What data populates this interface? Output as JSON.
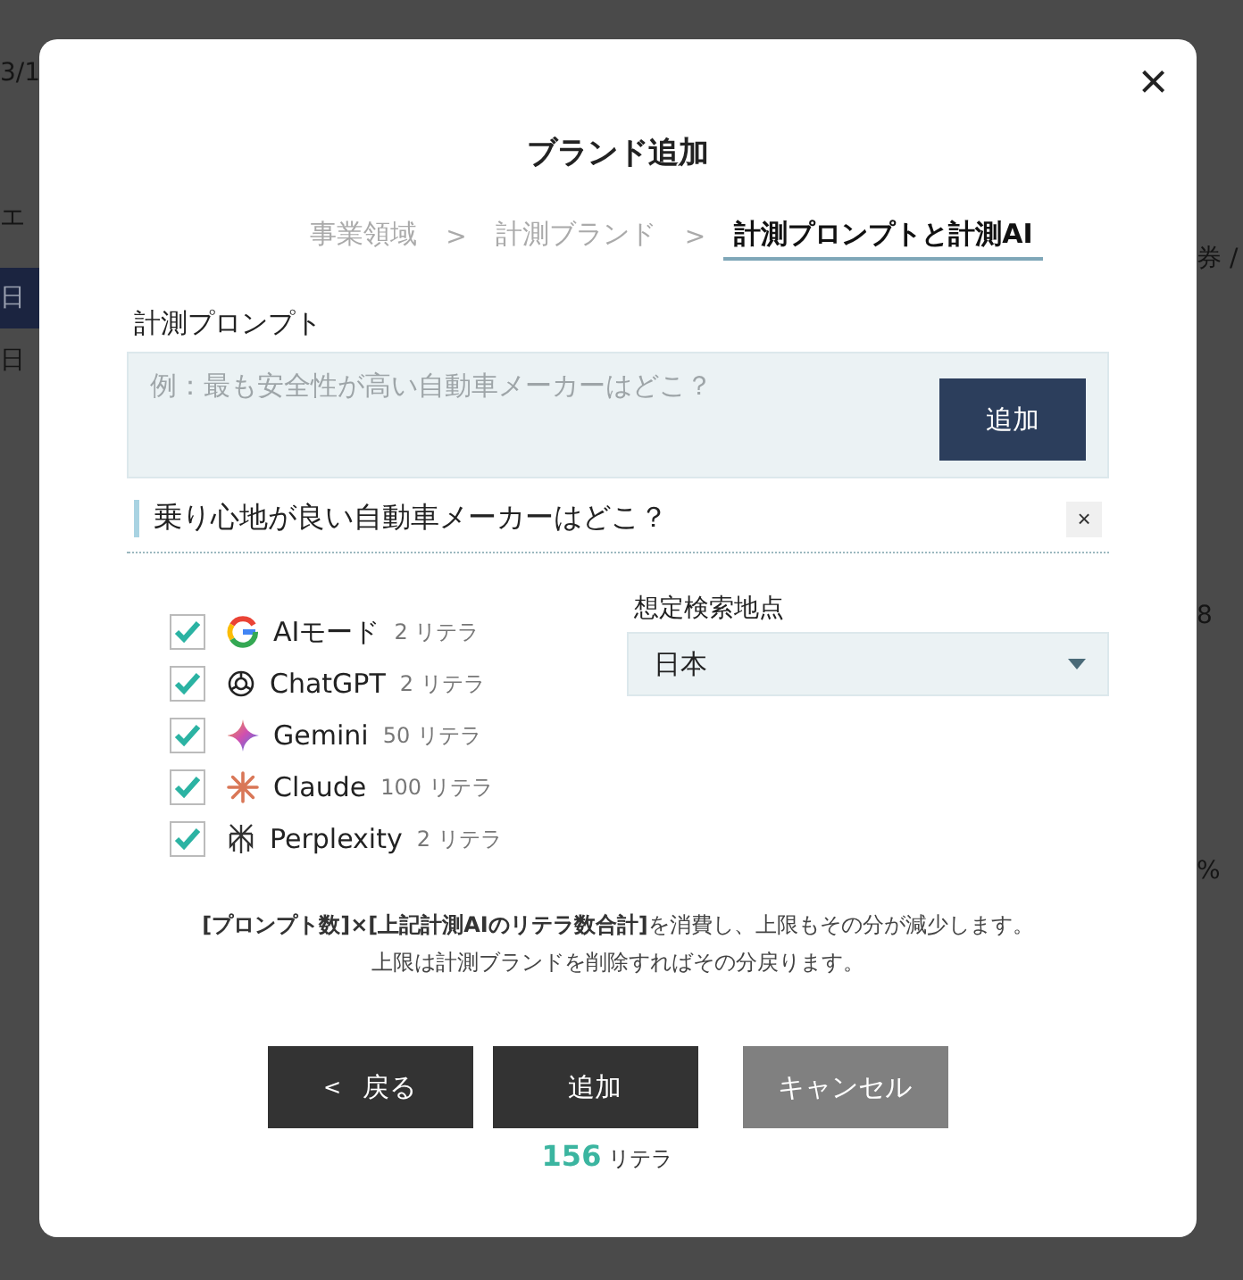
{
  "background_page": {
    "left_texts": [
      "3/1",
      "エ",
      "日",
      "日"
    ],
    "right_texts": [
      "券 /",
      "8",
      "%"
    ]
  },
  "dialog": {
    "title": "ブランド追加",
    "close_label": "×",
    "steps": [
      {
        "label": "事業領域",
        "selected": false
      },
      {
        "label": "計測ブランド",
        "selected": false
      },
      {
        "label": "計測プロンプトと計測AI",
        "selected": true
      }
    ],
    "step_separator": ">",
    "prompt_label": "計測プロンプト",
    "prompt_input": {
      "placeholder": "例：最も安全性が高い自動車メーカーはどこ？"
    },
    "prompt_add_button": "追加",
    "prompts": [
      {
        "text": "乗り心地が良い自動車メーカーはどこ？",
        "remove_label": "×"
      }
    ],
    "ai_models": [
      {
        "kind": "google",
        "name": "AIモード",
        "cost": "2",
        "unit": "リテラ",
        "checked": true
      },
      {
        "kind": "chatgpt",
        "name": "ChatGPT",
        "cost": "2",
        "unit": "リテラ",
        "checked": true
      },
      {
        "kind": "gemini",
        "name": "Gemini",
        "cost": "50",
        "unit": "リテラ",
        "checked": true
      },
      {
        "kind": "claude",
        "name": "Claude",
        "cost": "100",
        "unit": "リテラ",
        "checked": true
      },
      {
        "kind": "perplexity",
        "name": "Perplexity",
        "cost": "2",
        "unit": "リテラ",
        "checked": true
      }
    ],
    "location_label": "想定検索地点",
    "location_value": "日本",
    "notes": [
      "**[プロンプト数]×[上記計測AIのリテラ数合計]**を消費し、上限もその分が減少します。",
      "上限は計測ブランドを削除すればその分戻ります。"
    ],
    "back_button": {
      "icon": "<",
      "label": "戻る"
    },
    "submit_button": "追加",
    "cancel_button": "キャンセル",
    "total": {
      "value": "156",
      "unit": "リテラ"
    }
  }
}
